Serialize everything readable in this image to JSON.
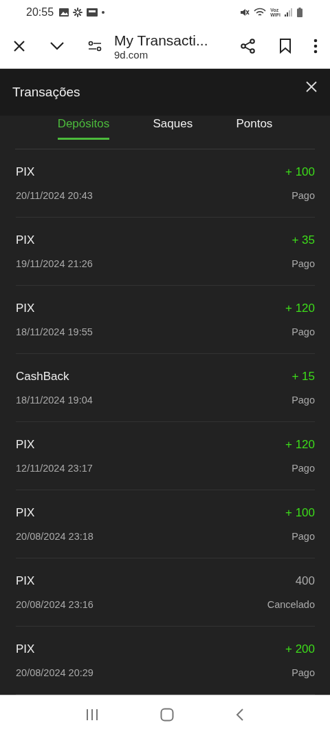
{
  "status_bar": {
    "time": "20:55",
    "network_label": [
      "Voz",
      "WiFi"
    ]
  },
  "browser": {
    "title": "My Transacti...",
    "url": "9d.com"
  },
  "dialog": {
    "title": "Transações"
  },
  "tabs": [
    {
      "label": "Depósitos",
      "selected": true
    },
    {
      "label": "Saques",
      "selected": false
    },
    {
      "label": "Pontos",
      "selected": false
    }
  ],
  "transactions": [
    {
      "method": "PIX",
      "date": "20/11/2024 20:43",
      "amount": "+ 100",
      "status": "Pago",
      "kind": "credit"
    },
    {
      "method": "PIX",
      "date": "19/11/2024 21:26",
      "amount": "+ 35",
      "status": "Pago",
      "kind": "credit"
    },
    {
      "method": "PIX",
      "date": "18/11/2024 19:55",
      "amount": "+ 120",
      "status": "Pago",
      "kind": "credit"
    },
    {
      "method": "CashBack",
      "date": "18/11/2024 19:04",
      "amount": "+ 15",
      "status": "Pago",
      "kind": "credit"
    },
    {
      "method": "PIX",
      "date": "12/11/2024 23:17",
      "amount": "+ 120",
      "status": "Pago",
      "kind": "credit"
    },
    {
      "method": "PIX",
      "date": "20/08/2024 23:18",
      "amount": "+ 100",
      "status": "Pago",
      "kind": "credit"
    },
    {
      "method": "PIX",
      "date": "20/08/2024 23:16",
      "amount": "400",
      "status": "Cancelado",
      "kind": "cancelled"
    },
    {
      "method": "PIX",
      "date": "20/08/2024 20:29",
      "amount": "+ 200",
      "status": "Pago",
      "kind": "credit"
    }
  ]
}
